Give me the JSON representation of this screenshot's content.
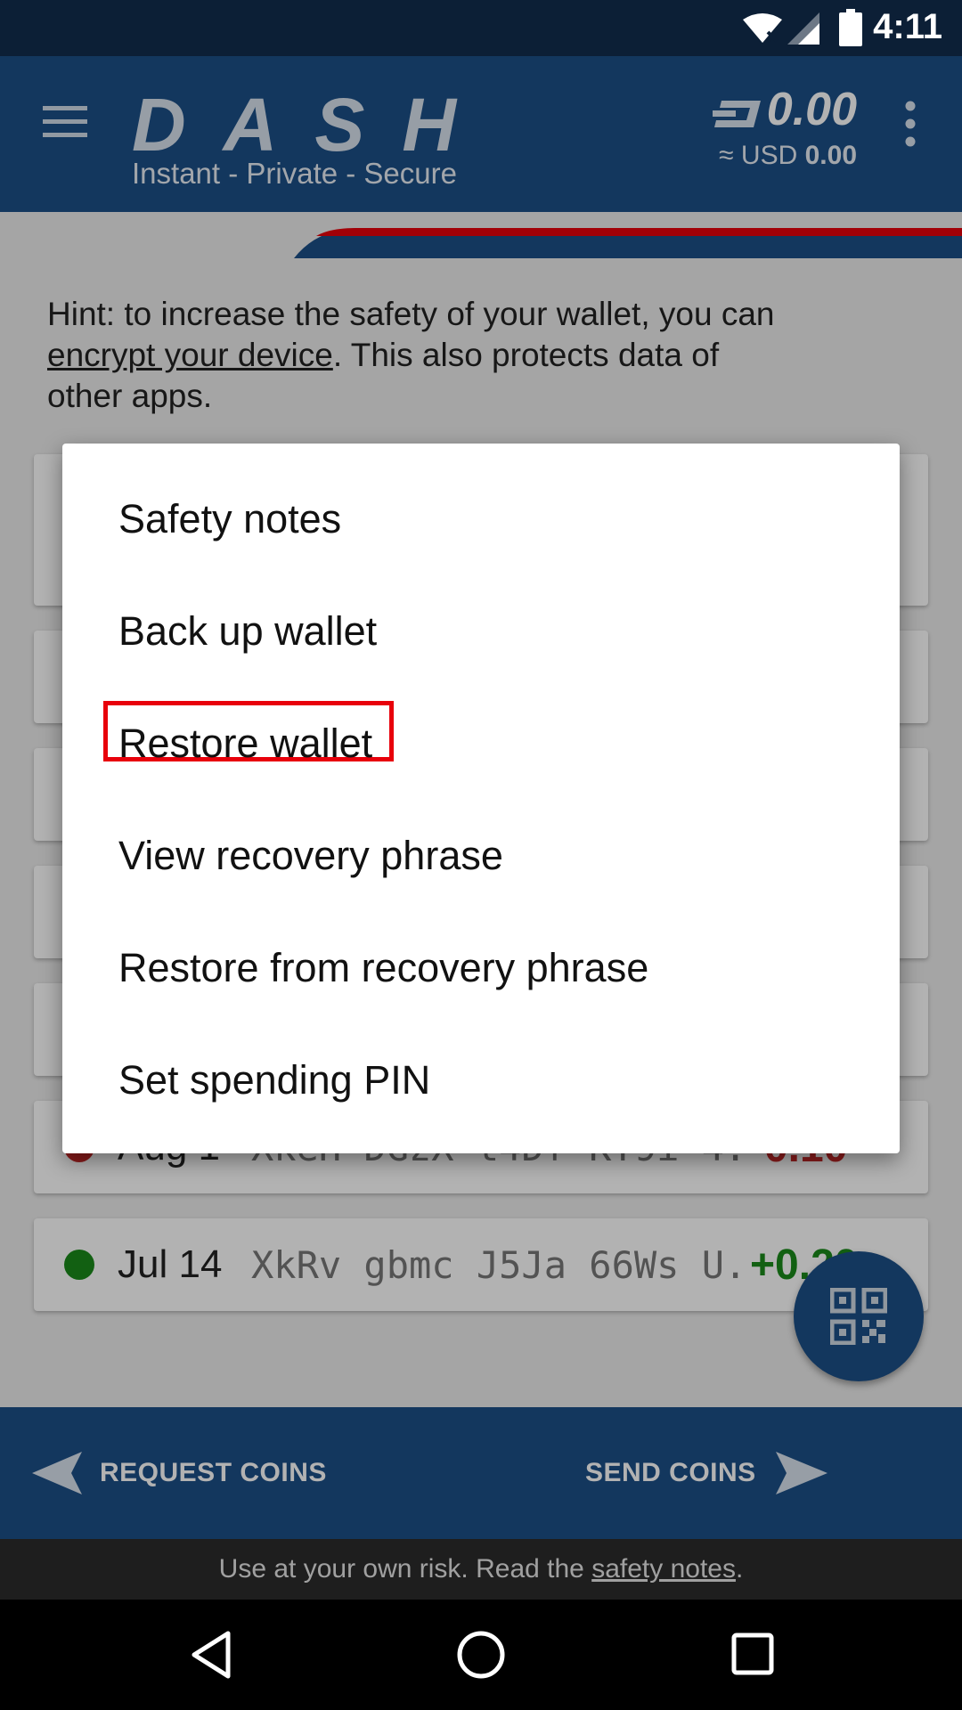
{
  "status_bar": {
    "time": "4:11"
  },
  "header": {
    "logo_text": "DASH",
    "tagline": "Instant - Private - Secure",
    "balance": "0.00",
    "fiat_prefix": "≈ USD",
    "fiat_value": "0.00"
  },
  "hint": {
    "prefix": "Hint: to increase the safety of your wallet, you can ",
    "link": "encrypt your device",
    "suffix": ". This also protects data of other apps."
  },
  "transactions": [
    {
      "date": "Aug 1",
      "address": "XkeH DGzX t4Df KY9i 4...",
      "amount": "-0.10",
      "color": "#c62828"
    },
    {
      "date": "Jul 14",
      "address": "XkRv gbmc J5Ja 66Ws U...",
      "amount": "+0.20",
      "color": "#1b8a1b"
    }
  ],
  "menu": {
    "items": [
      "Safety notes",
      "Back up wallet",
      "Restore wallet",
      "View recovery phrase",
      "Restore from recovery phrase",
      "Set spending PIN"
    ]
  },
  "actions": {
    "request": "REQUEST COINS",
    "send": "SEND COINS"
  },
  "footer": {
    "prefix": "Use at your own risk. Read the ",
    "link": "safety notes",
    "suffix": "."
  },
  "colors": {
    "primary": "#1c4f87",
    "status_bar": "#0c1f36",
    "highlight": "#e8000b",
    "accent_red": "#c62828"
  }
}
